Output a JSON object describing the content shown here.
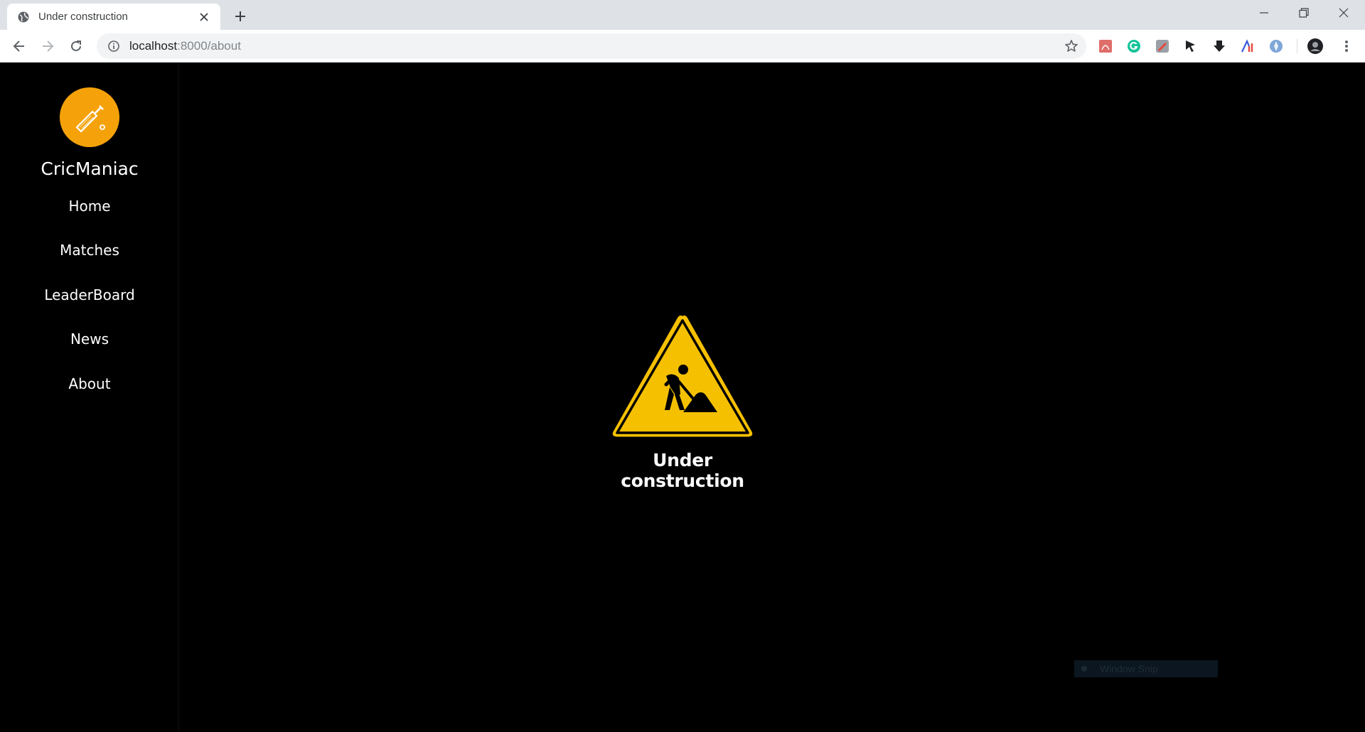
{
  "browser": {
    "tab_title": "Under construction",
    "url_host": "localhost",
    "url_path": ":8000/about"
  },
  "sidebar": {
    "brand": "CricManiac",
    "items": [
      {
        "label": "Home"
      },
      {
        "label": "Matches"
      },
      {
        "label": "LeaderBoard"
      },
      {
        "label": "News"
      },
      {
        "label": "About"
      }
    ]
  },
  "main": {
    "message": "Under construction"
  },
  "overlay": {
    "snip_label": "Window Snip"
  },
  "colors": {
    "accent": "#f5a20a",
    "sign_yellow": "#f5c000",
    "background": "#000000"
  }
}
